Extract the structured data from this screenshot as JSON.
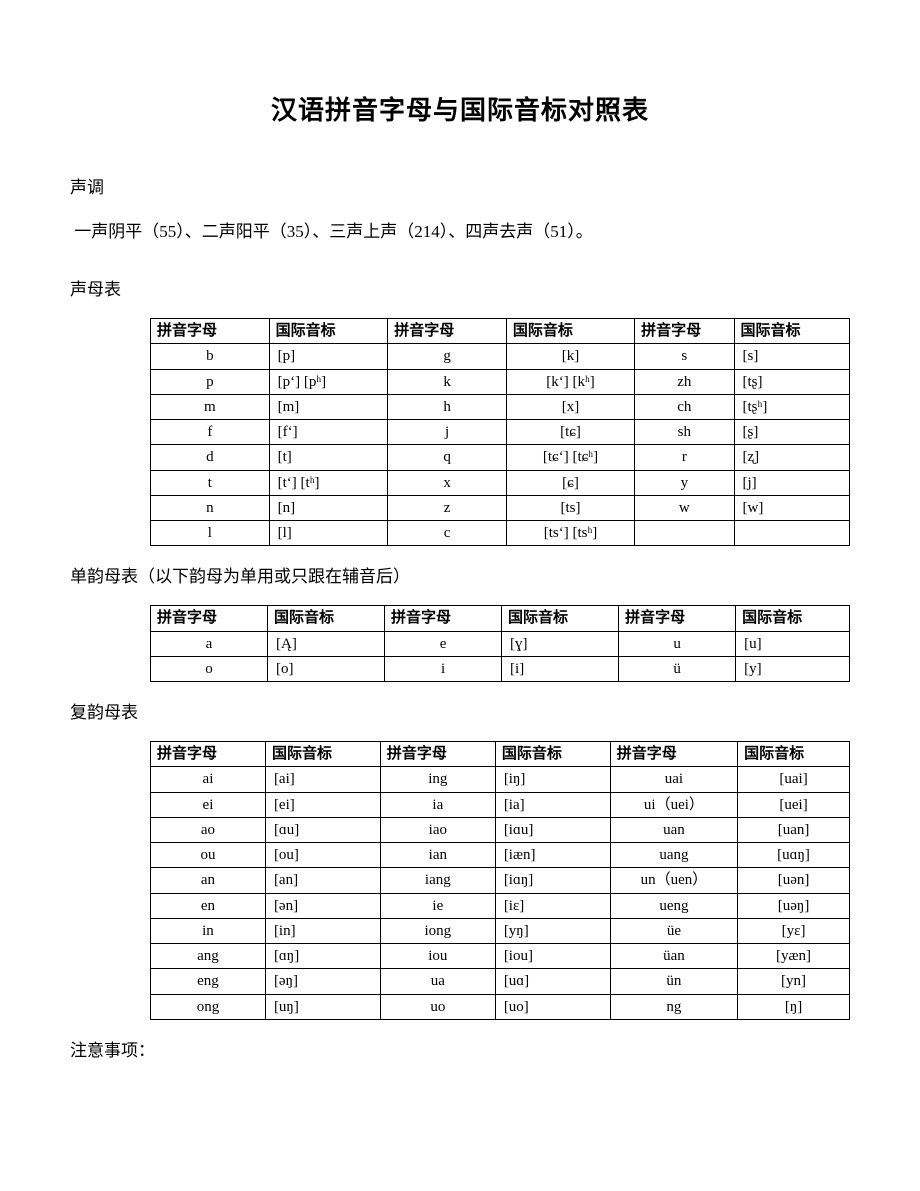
{
  "title": "汉语拼音字母与国际音标对照表",
  "section_tones_h": "声调",
  "tones_line": " 一声阴平（55）、二声阳平（35）、三声上声（214）、四声去声（51）。",
  "section_initials_h": "声母表",
  "headers": {
    "py": "拼音字母",
    "ipa": "国际音标",
    "py_wrap": "拼音字母"
  },
  "table_initials": {
    "rows": [
      {
        "p1": "b",
        "i1": "[p]",
        "p2": "g",
        "i2": "[k]",
        "p3": "s",
        "i3": "[s]"
      },
      {
        "p1": "p",
        "i1": "[pʻ] [pʰ]",
        "p2": "k",
        "i2": "[kʻ] [kʰ]",
        "p3": "zh",
        "i3": "[tʂ]"
      },
      {
        "p1": "m",
        "i1": "[m]",
        "p2": "h",
        "i2": "[x]",
        "p3": "ch",
        "i3": "[tʂʰ]"
      },
      {
        "p1": "f",
        "i1": "[fʻ]",
        "p2": "j",
        "i2": "[tɕ]",
        "p3": "sh",
        "i3": "[ʂ]"
      },
      {
        "p1": "d",
        "i1": "[t]",
        "p2": "q",
        "i2": "[tɕʻ] [tɕʰ]",
        "p3": "r",
        "i3": "[ʐ]"
      },
      {
        "p1": "t",
        "i1": "[tʻ] [tʰ]",
        "p2": "x",
        "i2": "[ɕ]",
        "p3": "y",
        "i3": "[j]"
      },
      {
        "p1": "n",
        "i1": "[n]",
        "p2": "z",
        "i2": "[ts]",
        "p3": "w",
        "i3": "[w]"
      },
      {
        "p1": "l",
        "i1": "[l]",
        "p2": "c",
        "i2": "[tsʻ] [tsʰ]",
        "p3": "",
        "i3": ""
      }
    ]
  },
  "section_simple_h": "单韵母表（以下韵母为单用或只跟在辅音后）",
  "table_simple": {
    "rows": [
      {
        "p1": "a",
        "i1": "[Ą]",
        "p2": "e",
        "i2": "[ɣ]",
        "p3": "u",
        "i3": "[u]"
      },
      {
        "p1": "o",
        "i1": "[o]",
        "p2": "i",
        "i2": "[i]",
        "p3": "ü",
        "i3": "[y]"
      }
    ]
  },
  "section_comp_h": "复韵母表",
  "table_comp": {
    "rows": [
      {
        "p1": "ai",
        "i1": "[ai]",
        "p2": "ing",
        "i2": "[iŋ]",
        "p3": "uai",
        "i3": "[uai]"
      },
      {
        "p1": "ei",
        "i1": "[ei]",
        "p2": "ia",
        "i2": "[ia]",
        "p3": "ui（uei）",
        "i3": "[uei]"
      },
      {
        "p1": "ao",
        "i1": "[ɑu]",
        "p2": "iao",
        "i2": "[iɑu]",
        "p3": "uan",
        "i3": "[uan]"
      },
      {
        "p1": "ou",
        "i1": "[ou]",
        "p2": "ian",
        "i2": "[iæn]",
        "p3": "uang",
        "i3": "[uɑŋ]"
      },
      {
        "p1": "an",
        "i1": "[an]",
        "p2": "iang",
        "i2": "[iɑŋ]",
        "p3": "un（uen）",
        "i3": "[uən]"
      },
      {
        "p1": "en",
        "i1": "[ən]",
        "p2": "ie",
        "i2": "[iɛ]",
        "p3": "ueng",
        "i3": "[uəŋ]"
      },
      {
        "p1": "in",
        "i1": "[in]",
        "p2": "iong",
        "i2": "[yŋ]",
        "p3": "üe",
        "i3": "[yɛ]"
      },
      {
        "p1": "ang",
        "i1": "[ɑŋ]",
        "p2": "iou",
        "i2": "[iou]",
        "p3": "üan",
        "i3": "[yæn]"
      },
      {
        "p1": "eng",
        "i1": "[əŋ]",
        "p2": "ua",
        "i2": "[uɑ]",
        "p3": "ün",
        "i3": "[yn]"
      },
      {
        "p1": "ong",
        "i1": "[uŋ]",
        "p2": "uo",
        "i2": "[uo]",
        "p3": "ng",
        "i3": "[ŋ]"
      }
    ]
  },
  "section_notes_h": "注意事项："
}
